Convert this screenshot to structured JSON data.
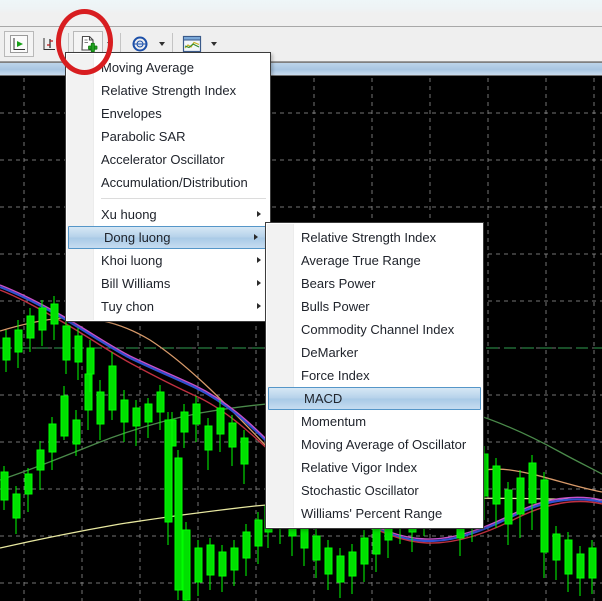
{
  "window": {
    "title_bar_color": "#a9c6e2",
    "toolbar_bg": "#efefef",
    "chart_bg": "#000000"
  },
  "toolbar": {
    "buttons": [
      {
        "name": "bar-chart-button",
        "icon": "bar-chart-icon",
        "has_dropdown": false
      },
      {
        "name": "candlestick-chart-button",
        "icon": "candlestick-chart-icon",
        "has_dropdown": false
      },
      {
        "name": "add-indicator-button",
        "icon": "add-indicator-icon",
        "has_dropdown": true,
        "highlighted": true
      },
      {
        "name": "objects-button",
        "icon": "object-circle-icon",
        "has_dropdown": true
      },
      {
        "name": "templates-button",
        "icon": "template-chart-icon",
        "has_dropdown": true
      }
    ]
  },
  "annotation": {
    "shape": "ellipse",
    "color": "#d81d20",
    "target": "add-indicator-button"
  },
  "menu_indicators": {
    "name": "indicators-menu",
    "recent_items": [
      "Moving Average",
      "Relative Strength Index",
      "Envelopes",
      "Parabolic SAR",
      "Accelerator Oscillator",
      "Accumulation/Distribution"
    ],
    "category_items": [
      {
        "label": "Xu huong",
        "has_submenu": true,
        "selected": false
      },
      {
        "label": "Dong luong",
        "has_submenu": true,
        "selected": true
      },
      {
        "label": "Khoi luong",
        "has_submenu": true,
        "selected": false
      },
      {
        "label": "Bill Williams",
        "has_submenu": true,
        "selected": false
      },
      {
        "label": "Tuy chon",
        "has_submenu": true,
        "selected": false
      }
    ]
  },
  "submenu_dongluong": {
    "name": "dong-luong-submenu",
    "items": [
      {
        "label": "Relative Strength Index",
        "selected": false
      },
      {
        "label": "Average True Range",
        "selected": false
      },
      {
        "label": "Bears Power",
        "selected": false
      },
      {
        "label": "Bulls Power",
        "selected": false
      },
      {
        "label": "Commodity Channel Index",
        "selected": false
      },
      {
        "label": "DeMarker",
        "selected": false
      },
      {
        "label": "Force Index",
        "selected": false
      },
      {
        "label": "MACD",
        "selected": true
      },
      {
        "label": "Momentum",
        "selected": false
      },
      {
        "label": "Moving Average of Oscillator",
        "selected": false
      },
      {
        "label": "Relative Vigor Index",
        "selected": false
      },
      {
        "label": "Stochastic Oscillator",
        "selected": false
      },
      {
        "label": "Williams' Percent Range",
        "selected": false
      }
    ]
  },
  "chart_data": {
    "type": "line",
    "title": "",
    "xlabel": "",
    "ylabel": "",
    "background": "#000000",
    "grid": true,
    "grid_color": "#8a8a8a",
    "grid_style": "dashed",
    "candle_body_color": "#00e000",
    "candle_outline_color": "#00ff00",
    "series": [
      {
        "name": "ma-fast-magenta",
        "color": "#c850c8"
      },
      {
        "name": "ma-slow-red",
        "color": "#c03040"
      },
      {
        "name": "ma-orange",
        "color": "#d89a6a"
      },
      {
        "name": "ma-green",
        "color": "#4a8a4a"
      },
      {
        "name": "ma-yellow",
        "color": "#e8e8a0"
      },
      {
        "name": "ma-blue",
        "color": "#3050d0"
      }
    ],
    "horizontal_level_color": "#2f9e4f"
  }
}
